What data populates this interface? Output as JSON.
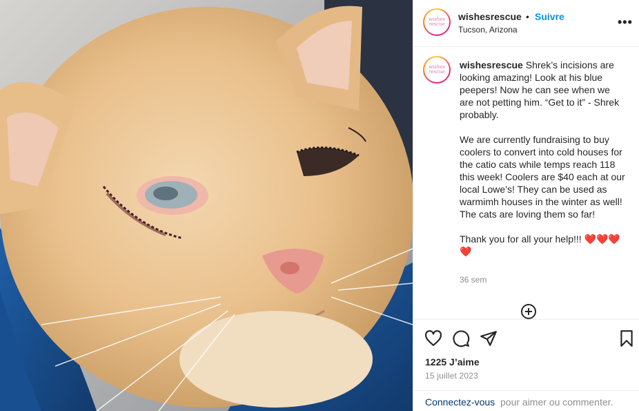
{
  "post": {
    "username": "wishesrescue",
    "separator": "•",
    "follow_label": "Suivre",
    "location": "Tucson, Arizona",
    "more_icon": "more-horizontal-icon",
    "avatar_logo_text": "wishes rescue",
    "image_alt": "Close-up of an orange cat with stitched eyelid incisions wrapped in a blue blanket"
  },
  "caption": {
    "username": "wishesrescue",
    "paragraph1": "Shrek’s incisions are looking amazing! Look at his blue peepers! Now he can see when we are not petting him. “Get to it” - Shrek probably.",
    "paragraph2": "We are currently fundraising to buy coolers to convert into cold houses for the catio cats while temps reach 118 this week! Coolers are $40 each at our local Lowe’s! They can be used as warmimh houses in the winter as well! The cats are loving them so far!",
    "paragraph3": "Thank you for all your help!!!",
    "hearts": "❤️❤️❤️❤️",
    "time_ago": "36 sem"
  },
  "actions": {
    "like_icon": "heart-outline-icon",
    "comment_icon": "comment-bubble-icon",
    "share_icon": "share-paper-plane-icon",
    "save_icon": "bookmark-icon",
    "load_more_icon": "plus-circle-icon"
  },
  "stats": {
    "likes": "1225 J’aime",
    "date": "15 juillet 2023"
  },
  "footer": {
    "login_link": "Connectez-vous",
    "login_rest": "pour aimer ou commenter."
  },
  "colors": {
    "link_blue": "#0095f6",
    "text": "#262626",
    "muted": "#8e8e8e",
    "heart_red": "#e0245e"
  }
}
